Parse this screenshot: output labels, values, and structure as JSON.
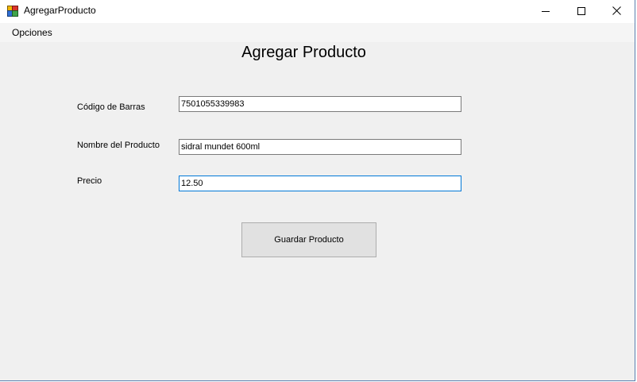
{
  "window": {
    "title": "AgregarProducto",
    "icon": "winforms-app-icon",
    "controls": {
      "minimize": "minimize-icon",
      "maximize": "maximize-icon",
      "close": "close-icon"
    }
  },
  "menu": {
    "items": [
      {
        "label": "Opciones"
      }
    ]
  },
  "form": {
    "title": "Agregar Producto",
    "fields": {
      "barcode": {
        "label": "Código de Barras",
        "value": "7501055339983"
      },
      "product_name": {
        "label": "Nombre del Producto",
        "value": "sidral mundet 600ml"
      },
      "price": {
        "label": "Precio",
        "value": "12.50"
      }
    },
    "save_button_label": "Guardar Producto"
  },
  "colors": {
    "focus_border": "#0078d7",
    "window_background": "#f0f0f0",
    "button_background": "#e1e1e1"
  }
}
